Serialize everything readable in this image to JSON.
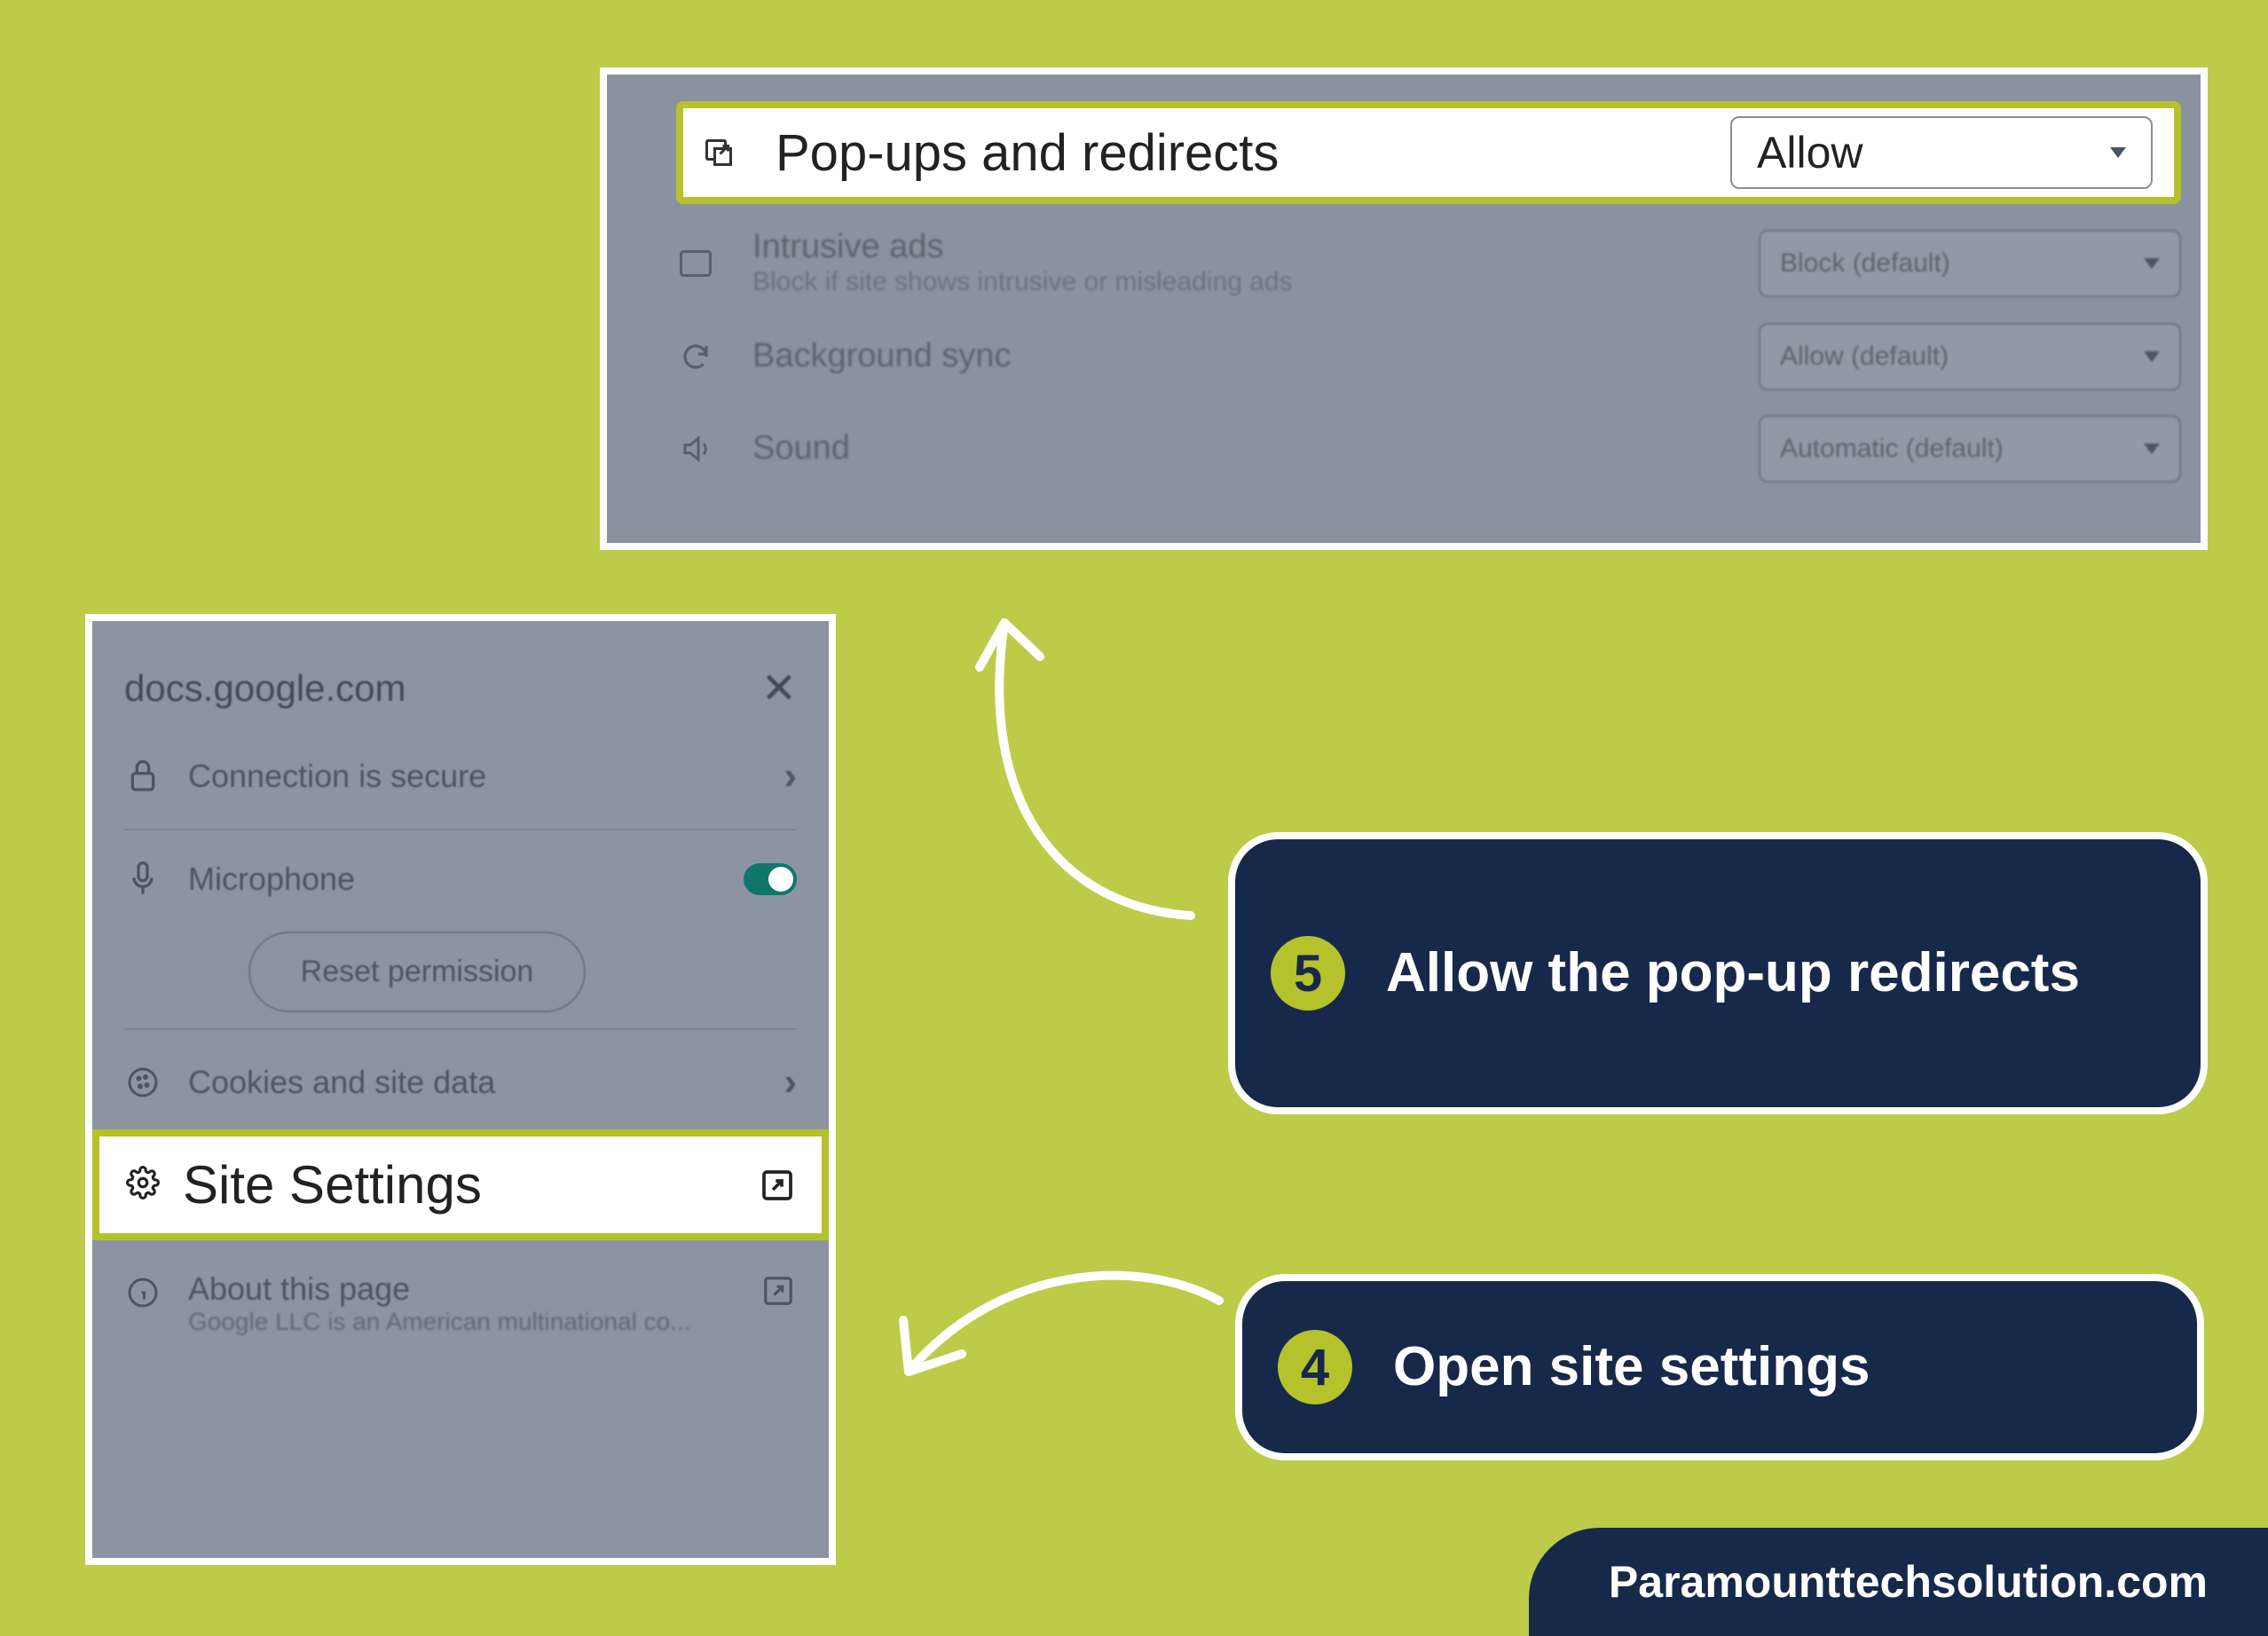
{
  "top_panel": {
    "popups": {
      "label": "Pop-ups and redirects",
      "select": "Allow"
    },
    "ads": {
      "title": "Intrusive ads",
      "sub": "Block if site shows intrusive or misleading ads",
      "select": "Block (default)"
    },
    "bg": {
      "title": "Background sync",
      "select": "Allow (default)"
    },
    "sound": {
      "title": "Sound",
      "select": "Automatic (default)"
    }
  },
  "left_popup": {
    "domain": "docs.google.com",
    "secure": "Connection is secure",
    "mic": "Microphone",
    "reset": "Reset permission",
    "cookies": "Cookies and site data",
    "site_settings": "Site Settings",
    "about_title": "About this page",
    "about_sub": "Google LLC is an American multinational co..."
  },
  "callouts": {
    "step5_num": "5",
    "step5_text": "Allow the pop-up redirects",
    "step4_num": "4",
    "step4_text": "Open site settings"
  },
  "footer": "Paramounttechsolution.com"
}
